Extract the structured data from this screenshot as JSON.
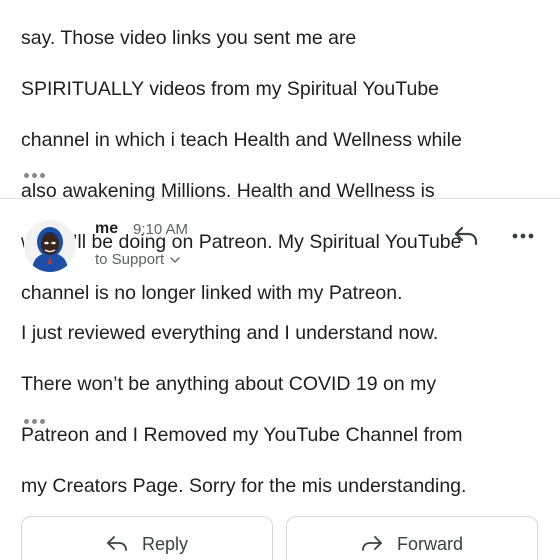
{
  "previous_message": {
    "lines": [
      "say. Those video links you sent me are",
      "SPIRITUALLY videos from my Spiritual YouTube",
      "channel in which i teach Health and Wellness while",
      "also awakening Millions. Health and Wellness is",
      "what I’ll be doing on Patreon. My Spiritual YouTube",
      "channel is no longer linked with my Patreon."
    ]
  },
  "message": {
    "sender": "me",
    "time": "9:10 AM",
    "recipient_line": "to Support",
    "body_lines": [
      "I just reviewed everything and I understand now.",
      "There won’t be anything about COVID 19 on my",
      "Patreon and I Removed my YouTube Channel from",
      "my Creators Page. Sorry for the mis understanding."
    ]
  },
  "actions": {
    "reply_label": "Reply",
    "forward_label": "Forward"
  },
  "icons": {
    "reply": "reply-arrow-icon",
    "more": "more-vertical-dots-icon",
    "expand": "chevron-down-icon",
    "trimmed": "trimmed-content-dots-icon",
    "forward": "forward-arrow-icon"
  },
  "colors": {
    "text": "#1f1f1f",
    "secondary": "#5f6368",
    "avatar_blue": "#1c4fa8"
  }
}
